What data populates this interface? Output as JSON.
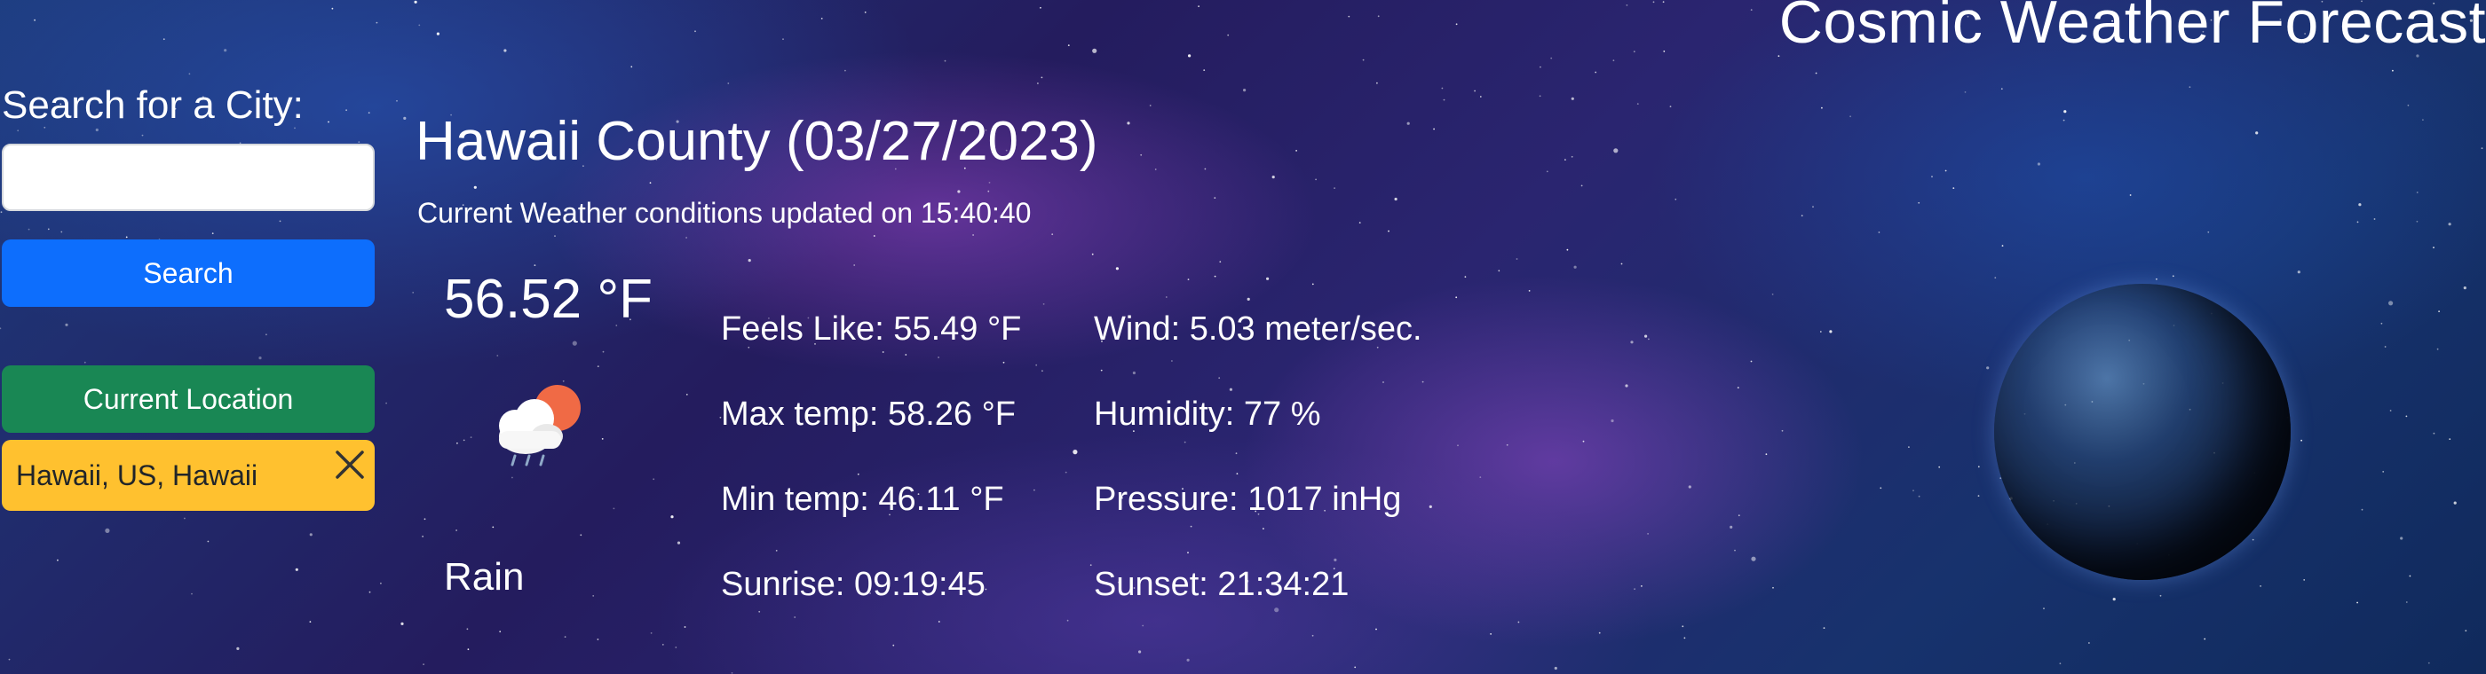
{
  "header": {
    "title": "Cosmic Weather Forecast"
  },
  "sidebar": {
    "title": "Search for a City:",
    "search_value": "",
    "search_button": "Search",
    "location_button": "Current Location",
    "history": [
      {
        "label": "Hawaii, US, Hawaii"
      }
    ]
  },
  "weather": {
    "city_heading": "Hawaii County (03/27/2023)",
    "updated": "Current Weather conditions updated on 15:40:40",
    "temperature": "56.52 °F",
    "condition": "Rain",
    "icon": "cloud-sun-rain-icon",
    "stats": {
      "feels_like": "Feels Like: 55.49 °F",
      "max_temp": "Max temp: 58.26 °F",
      "min_temp": "Min temp: 46.11 °F",
      "sunrise": "Sunrise: 09:19:45",
      "wind": "Wind: 5.03 meter/sec.",
      "humidity": "Humidity: 77 %",
      "pressure": "Pressure: 1017 inHg",
      "sunset": "Sunset: 21:34:21"
    }
  },
  "colors": {
    "search_button": "#0d6efd",
    "location_button": "#198754",
    "history_item": "#ffc12f",
    "text": "#ffffff"
  }
}
